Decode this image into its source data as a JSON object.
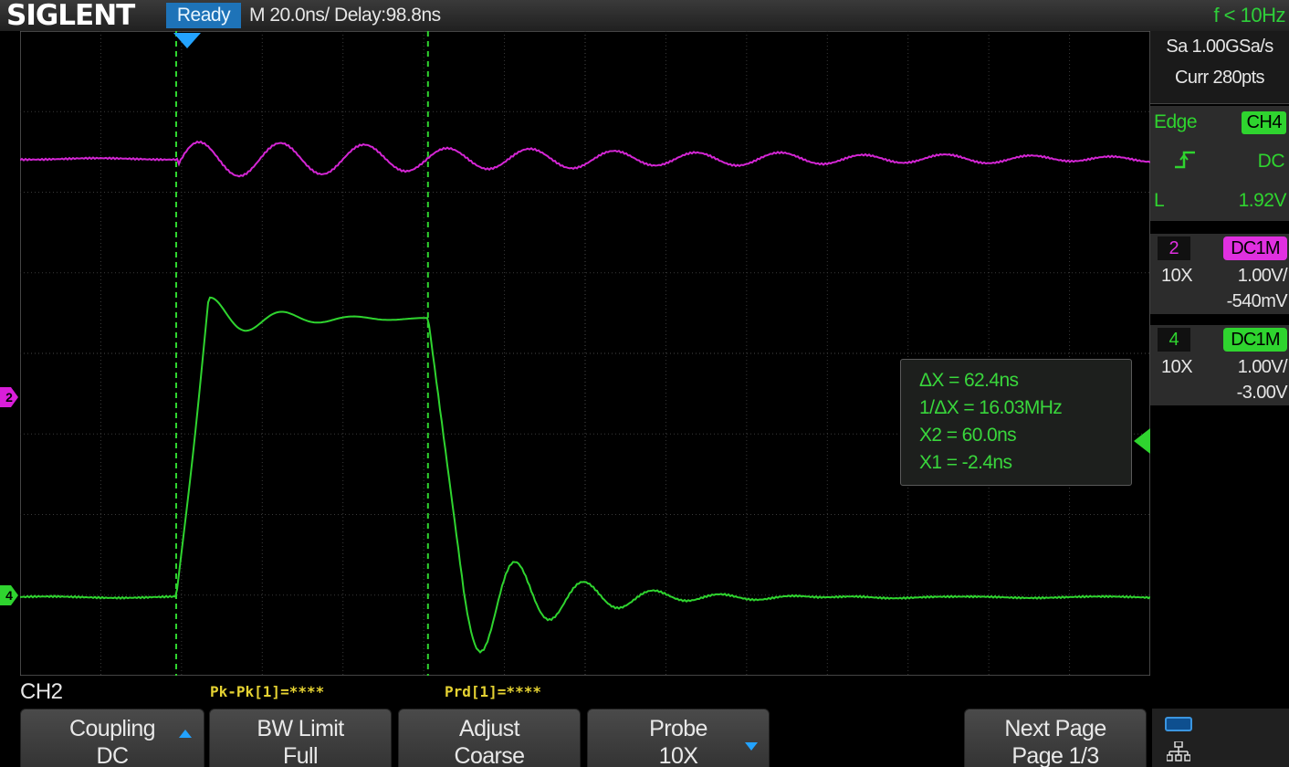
{
  "topbar": {
    "logo": "SIGLENT",
    "status": "Ready",
    "timebase": "M 20.0ns/  Delay:98.8ns",
    "frequency": "f < 10Hz"
  },
  "acquisition": {
    "sample_rate": "Sa 1.00GSa/s",
    "memory": "Curr 280pts"
  },
  "trigger": {
    "type": "Edge",
    "source": "CH4",
    "coupling": "DC",
    "level_label": "L",
    "level": "1.92V"
  },
  "channels": [
    {
      "num": "2",
      "coupling": "DC1M",
      "probe": "10X",
      "scale": "1.00V/",
      "offset": "-540mV",
      "color": "#e030e0"
    },
    {
      "num": "4",
      "coupling": "DC1M",
      "probe": "10X",
      "scale": "1.00V/",
      "offset": "-3.00V",
      "color": "#2fd42f"
    }
  ],
  "markers": {
    "ch2": "2",
    "ch4": "4"
  },
  "cursors": {
    "delta_x": "ΔX = 62.4ns",
    "inv_delta_x": "1/ΔX = 16.03MHz",
    "x2": "X2 = 60.0ns",
    "x1": "X1 = -2.4ns",
    "x1_ns": -2.4,
    "x2_ns": 60.0
  },
  "measurements": [
    "Pk-Pk[1]=****",
    "Prd[1]=****"
  ],
  "menu": {
    "title": "CH2",
    "softkeys": [
      {
        "line1": "Coupling",
        "line2": "DC"
      },
      {
        "line1": "BW Limit",
        "line2": "Full"
      },
      {
        "line1": "Adjust",
        "line2": "Coarse"
      },
      {
        "line1": "Probe",
        "line2": "10X"
      },
      {
        "line1": "Next Page",
        "line2": "Page 1/3"
      }
    ]
  }
}
